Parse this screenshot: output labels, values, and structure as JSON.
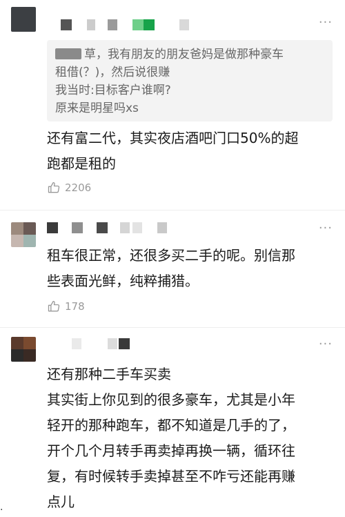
{
  "comments": [
    {
      "quote_lines": [
        "草，我有朋友的朋友爸妈是做那种豪车",
        "租借(？)，然后说很赚",
        "我当时:目标客户谁啊?",
        "原来是明星吗xs"
      ],
      "body": "还有富二代，其实夜店酒吧门口50%的超\n跑都是租的",
      "likes": "2206",
      "avatar_colors": [
        "#3c3f43"
      ],
      "name_colors": [
        "#555555",
        "#cccccc",
        "#9b9b9b",
        "#6fcf8a",
        "#17a34a",
        "#d9d9d9"
      ]
    },
    {
      "body": "租车很正常，还很多买二手的呢。别信那\n些表面光鲜，纯粹捕猎。",
      "likes": "178",
      "avatar_colors": [
        "#9c8a7d",
        "#6a5a55",
        "#c6b7b0",
        "#9fb5b0"
      ],
      "name_colors": [
        "#3b3b3b",
        "#8f8f8f",
        "#4a4a4a",
        "#d5d5d5",
        "#e3e3e3",
        "#c9c9c9"
      ]
    },
    {
      "body": "还有那种二手车买卖\n其实街上你见到的很多豪车，尤其是小年\n轻开的那种跑车，都不知道是几手的了，\n开个几个月转手再卖掉再换一辆，循环往\n复，有时候转手卖掉甚至不咋亏还能再赚\n点儿",
      "avatar_colors": [
        "#5a3a2c",
        "#7a4a2f",
        "#2b2b2b",
        "#3a2a24"
      ],
      "name_colors": [
        "#eaeaea",
        "#dcdcdc",
        "#3a3a3a"
      ]
    }
  ],
  "more_glyph": "···",
  "edge_mark": "."
}
